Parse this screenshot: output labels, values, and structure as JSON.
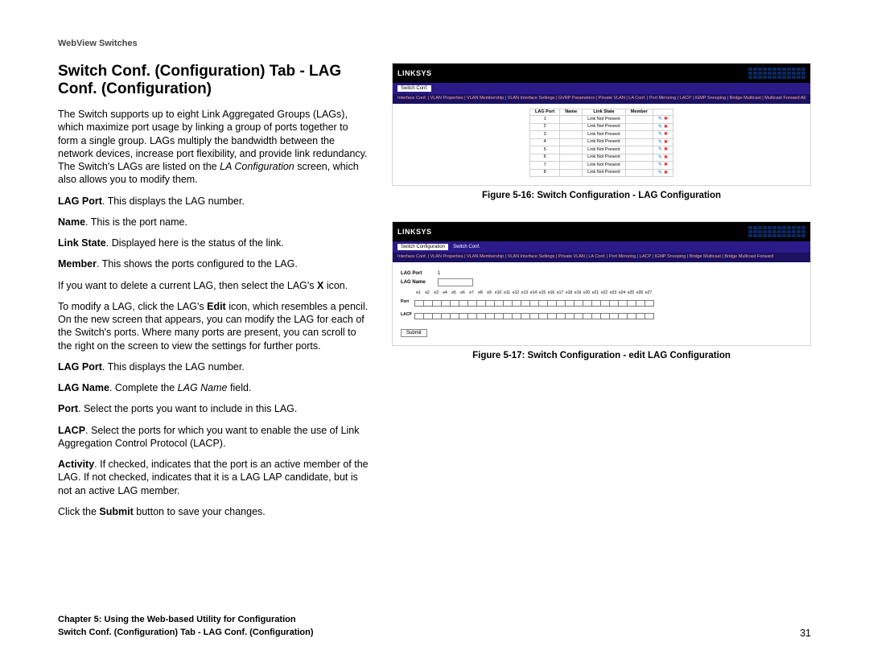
{
  "header": "WebView Switches",
  "title": "Switch Conf. (Configuration) Tab - LAG Conf. (Configuration)",
  "intro": "The Switch supports up to eight Link Aggregated Groups (LAGs), which maximize port usage by linking a group of ports together to form a single group. LAGs multiply the bandwidth between the network devices, increase port flexibility, and provide link redundancy. The Switch's LAGs are listed on the ",
  "intro_em": "LA Configuration",
  "intro_tail": " screen, which also allows you to modify them.",
  "defs1": [
    {
      "b": "LAG Port",
      "text": ". This displays the LAG number."
    },
    {
      "b": "Name",
      "text": ". This is the port name."
    },
    {
      "b": "Link State",
      "text": ". Displayed here is the status of the link."
    },
    {
      "b": "Member",
      "text": ". This shows the ports configured to the LAG."
    }
  ],
  "note_delete_pre": "If you want to delete a current LAG, then select the LAG's ",
  "note_delete_b": "X",
  "note_delete_post": " icon.",
  "note_modify_pre": "To modify a LAG, click the LAG's ",
  "note_modify_b": "Edit",
  "note_modify_post": " icon, which resembles a pencil. On the new screen that appears, you can modify the LAG for each of the Switch's ports. Where many ports are present, you can scroll to the right on the screen to view the settings for further ports.",
  "defs2": [
    {
      "b": "LAG Port",
      "text": ". This displays the LAG number."
    },
    {
      "b": "LAG Name",
      "text": ". Complete the ",
      "em": "LAG Name",
      "tail": " field."
    },
    {
      "b": "Port",
      "text": ". Select the ports you want to include in this LAG."
    },
    {
      "b": "LACP",
      "text": ". Select the ports for which you want to enable the use of Link Aggregation Control Protocol (LACP)."
    },
    {
      "b": "Activity",
      "text": ". If checked, indicates that the port is an active member of the LAG. If not checked, indicates that it is a LAG LAP candidate, but is not an active LAG member."
    }
  ],
  "submit_sentence_pre": "Click the ",
  "submit_sentence_b": "Submit",
  "submit_sentence_post": " button to save your changes.",
  "fig1": {
    "caption": "Figure 5-16: Switch Configuration - LAG Configuration",
    "brand": "LINKSYS",
    "tab_active_label": "Switch Conf.",
    "cols": [
      "LAG Port",
      "Name",
      "Link State",
      "Member"
    ],
    "rows": [
      {
        "lag": "1",
        "name": "",
        "state": "Link Not Present",
        "member": ""
      },
      {
        "lag": "2",
        "name": "",
        "state": "Link Not Present",
        "member": ""
      },
      {
        "lag": "3",
        "name": "",
        "state": "Link Not Present",
        "member": ""
      },
      {
        "lag": "4",
        "name": "",
        "state": "Link Not Present",
        "member": ""
      },
      {
        "lag": "5",
        "name": "",
        "state": "Link Not Present",
        "member": ""
      },
      {
        "lag": "6",
        "name": "",
        "state": "Link Not Present",
        "member": ""
      },
      {
        "lag": "7",
        "name": "",
        "state": "Link Not Present",
        "member": ""
      },
      {
        "lag": "8",
        "name": "",
        "state": "Link Not Present",
        "member": ""
      }
    ],
    "subtabs": "Interface Conf. | VLAN Properties | VLAN Membership | VLAN Interface Settings | GVRP Parameters | Private VLAN | LA Conf. | Port Mirroring | LACP | IGMP Snooping | Bridge Multicast | Multicast Forward All"
  },
  "fig2": {
    "caption": "Figure 5-17: Switch Configuration - edit LAG Configuration",
    "brand": "LINKSYS",
    "tab_active_label": "Switch Configuration",
    "subtab_white": "Switch Conf.",
    "subtabs": "Interface Conf. | VLAN Properties | VLAN Membership | VLAN Interface Settings | Private VLAN | LA Conf. | Port Mirroring | LACP | IGMP Snooping | Bridge Multicast | Bridge Multicast Forward",
    "lag_port_label": "LAG Port",
    "lag_port_value": "1",
    "lag_name_label": "LAG Name",
    "port_label": "Port",
    "lacp_label": "LACP",
    "ports": [
      "e1",
      "e2",
      "e3",
      "e4",
      "e5",
      "e6",
      "e7",
      "e8",
      "e9",
      "e10",
      "e11",
      "e12",
      "e13",
      "e14",
      "e15",
      "e16",
      "e17",
      "e18",
      "e19",
      "e20",
      "e21",
      "e22",
      "e23",
      "e24",
      "e25",
      "e26",
      "e27"
    ],
    "submit": "Submit"
  },
  "footer": {
    "chapter": "Chapter 5: Using the Web-based Utility for Configuration",
    "section": "Switch Conf. (Configuration) Tab - LAG Conf. (Configuration)",
    "page": "31"
  }
}
